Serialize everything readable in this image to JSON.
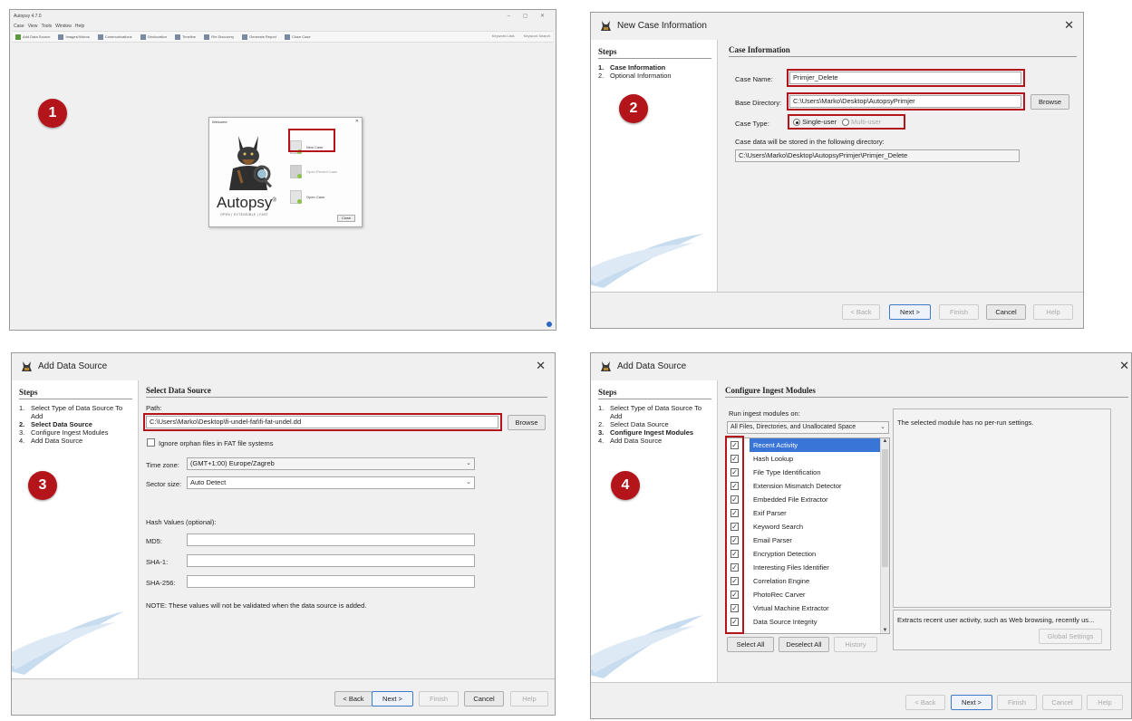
{
  "colors": {
    "highlight": "#b3151b",
    "accent": "#3f79c9",
    "selection": "#3875d7"
  },
  "panel1": {
    "badge": "1",
    "window_title": "Autopsy 4.7.0",
    "menu": [
      "Case",
      "View",
      "Tools",
      "Window",
      "Help"
    ],
    "toolbar": [
      "Add Data Source",
      "Images/Videos",
      "Communications",
      "Geolocation",
      "Timeline",
      "File Discovery",
      "Generate Report",
      "Close Case"
    ],
    "toolbar_right": [
      "Keyword Lists",
      "Keyword Search"
    ],
    "welcome": {
      "title": "Welcome",
      "logo": "Autopsy",
      "logo_mark": "®",
      "tagline": "OPEN | EXTENSIBLE | FAST",
      "new_case": "New Case",
      "open_recent": "Open Recent Case",
      "open_case": "Open Case",
      "close": "Close"
    }
  },
  "panel2": {
    "badge": "2",
    "title": "New Case Information",
    "steps_header": "Steps",
    "steps": [
      {
        "num": "1.",
        "label": "Case Information",
        "current": true
      },
      {
        "num": "2.",
        "label": "Optional Information",
        "current": false
      }
    ],
    "section": "Case Information",
    "case_name_label": "Case Name:",
    "case_name": "Primjer_Delete",
    "base_dir_label": "Base Directory:",
    "base_dir": "C:\\Users\\Marko\\Desktop\\AutopsyPrimjer",
    "browse": "Browse",
    "case_type_label": "Case Type:",
    "single_user": "Single-user",
    "multi_user": "Multi-user",
    "stored_label": "Case data will be stored in the following directory:",
    "stored_path": "C:\\Users\\Marko\\Desktop\\AutopsyPrimjer\\Primjer_Delete",
    "buttons": {
      "back": "< Back",
      "next": "Next >",
      "finish": "Finish",
      "cancel": "Cancel",
      "help": "Help"
    }
  },
  "panel3": {
    "badge": "3",
    "title": "Add Data Source",
    "steps_header": "Steps",
    "steps": [
      {
        "num": "1.",
        "label": "Select Type of Data Source To",
        "current": false
      },
      {
        "num": "",
        "label": "Add",
        "current": false
      },
      {
        "num": "2.",
        "label": "Select Data Source",
        "current": true
      },
      {
        "num": "3.",
        "label": "Configure Ingest Modules",
        "current": false
      },
      {
        "num": "4.",
        "label": "Add Data Source",
        "current": false
      }
    ],
    "section": "Select Data Source",
    "path_label": "Path:",
    "path": "C:\\Users\\Marko\\Desktop\\fi-undel-fat\\fi-fat-undel.dd",
    "browse": "Browse",
    "ignore_orphan": "Ignore orphan files in FAT file systems",
    "tz_label": "Time zone:",
    "tz": "(GMT+1:00) Europe/Zagreb",
    "sector_label": "Sector size:",
    "sector": "Auto Detect",
    "hash_label": "Hash Values (optional):",
    "md5": "MD5:",
    "sha1": "SHA-1:",
    "sha256": "SHA-256:",
    "note": "NOTE: These values will not be validated when the data source is added.",
    "buttons": {
      "back": "< Back",
      "next": "Next >",
      "finish": "Finish",
      "cancel": "Cancel",
      "help": "Help"
    }
  },
  "panel4": {
    "badge": "4",
    "title": "Add Data Source",
    "steps_header": "Steps",
    "steps": [
      {
        "num": "1.",
        "label": "Select Type of Data Source To",
        "current": false
      },
      {
        "num": "",
        "label": "Add",
        "current": false
      },
      {
        "num": "2.",
        "label": "Select Data Source",
        "current": false
      },
      {
        "num": "3.",
        "label": "Configure Ingest Modules",
        "current": true
      },
      {
        "num": "4.",
        "label": "Add Data Source",
        "current": false
      }
    ],
    "section": "Configure Ingest Modules",
    "run_on_label": "Run ingest modules on:",
    "run_on": "All Files, Directories, and Unallocated Space",
    "modules": [
      "Recent Activity",
      "Hash Lookup",
      "File Type Identification",
      "Extension Mismatch Detector",
      "Embedded File Extractor",
      "Exif Parser",
      "Keyword Search",
      "Email Parser",
      "Encryption Detection",
      "Interesting Files Identifier",
      "Correlation Engine",
      "PhotoRec Carver",
      "Virtual Machine Extractor",
      "Data Source Integrity"
    ],
    "no_settings": "The selected module has no per-run settings.",
    "description": "Extracts recent user activity, such as Web browsing, recently us...",
    "global_settings": "Global Settings",
    "select_all": "Select All",
    "deselect_all": "Deselect All",
    "history": "History",
    "buttons": {
      "back": "< Back",
      "next": "Next >",
      "finish": "Finish",
      "cancel": "Cancel",
      "help": "Help"
    }
  }
}
